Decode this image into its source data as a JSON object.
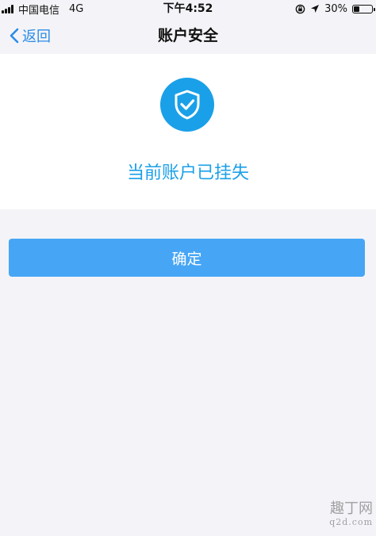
{
  "status_bar": {
    "carrier": "中国电信",
    "network": "4G",
    "time": "下午4:52",
    "battery": "30%",
    "battery_level": 0.3
  },
  "nav": {
    "back_label": "返回",
    "title": "账户安全"
  },
  "status_card": {
    "icon": "shield-check-icon",
    "message": "当前账户已挂失"
  },
  "confirm_label": "确定",
  "watermark": {
    "top": "趣丁网",
    "bottom": "q2d.com"
  },
  "colors": {
    "accent": "#1aa0e8",
    "button": "#46a6f5",
    "link": "#2b8ce6",
    "background": "#f4f4f8"
  }
}
